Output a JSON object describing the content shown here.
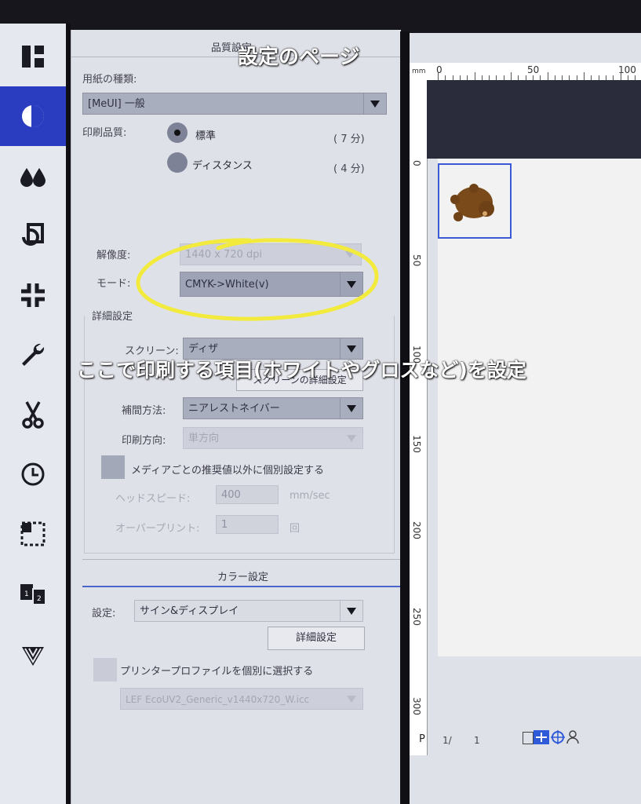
{
  "overlay": {
    "title": "設定のページ",
    "caption": "ここで印刷する項目(ホワイトやグロスなど)を設定",
    "highlight_color": "#f2ea3c"
  },
  "sidebar": {
    "items": [
      {
        "icon": "layout-icon"
      },
      {
        "icon": "contrast-icon",
        "active": true
      },
      {
        "icon": "ink-drops-icon"
      },
      {
        "icon": "copy-refresh-icon"
      },
      {
        "icon": "compress-icon"
      },
      {
        "icon": "wrench-icon"
      },
      {
        "icon": "scissors-icon"
      },
      {
        "icon": "clock-icon"
      },
      {
        "icon": "selection-icon"
      },
      {
        "icon": "pages-icon"
      },
      {
        "icon": "color-swatch-icon"
      }
    ],
    "accent": "#2a3cbf"
  },
  "panel": {
    "header": "品質設定",
    "media_type_label": "用紙の種類:",
    "media_type_value": "[MeUI] 一般",
    "quality_label": "印刷品質:",
    "quality_options": [
      {
        "label": "標準",
        "time": "( 7 分)",
        "selected": true
      },
      {
        "label": "ディスタンス",
        "time": "( 4 分)",
        "selected": false
      }
    ],
    "resolution_label": "解像度:",
    "resolution_value": "1440 x 720 dpi",
    "mode_label": "モード:",
    "mode_value": "CMYK->White(v)",
    "detail_header": "詳細設定",
    "screen_label": "スクリーン:",
    "screen_value": "ディザ",
    "screen_detail_button": "スクリーンの詳細設定",
    "interp_label": "補間方法:",
    "interp_value": "ニアレストネイバー",
    "direction_label": "印刷方向:",
    "direction_value": "単方向",
    "custom_checkbox_label": "メディアごとの推奨値以外に個別設定する",
    "head_speed_label": "ヘッドスピード:",
    "head_speed_value": "400",
    "head_speed_unit": "mm/sec",
    "overprint_label": "オーバープリント:",
    "overprint_value": "1",
    "overprint_unit": "回",
    "color_header": "カラー設定",
    "color_setting_label": "設定:",
    "color_setting_value": "サイン&ディスプレイ",
    "color_detail_button": "詳細設定",
    "profile_checkbox_label": "プリンタープロファイルを個別に選択する",
    "profile_value": "LEF EcoUV2_Generic_v1440x720_W.icc"
  },
  "preview": {
    "unit": "mm",
    "h_ruler": [
      "0",
      "50",
      "100"
    ],
    "v_ruler": [
      "0",
      "50",
      "100",
      "150",
      "200",
      "250",
      "300"
    ],
    "page_label": "P",
    "page_current": "1/",
    "page_total": "1",
    "status_icons": [
      "page-view-icon",
      "fit-icon",
      "target-icon",
      "user-icon"
    ]
  }
}
